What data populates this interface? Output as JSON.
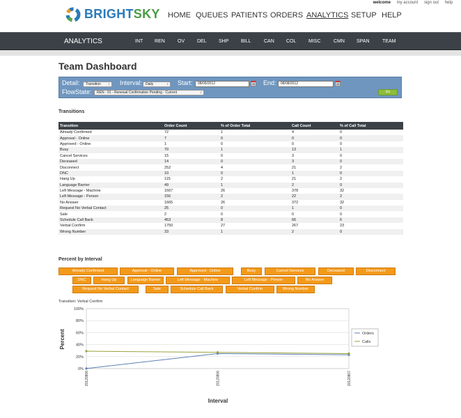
{
  "header": {
    "brand_a": "BRIGHT",
    "brand_b": "SKY",
    "util": {
      "welcome": "welcome",
      "account": "my account",
      "signout": "sign out",
      "help": "help"
    },
    "nav": [
      "HOME",
      "QUEUES",
      "PATIENTS",
      "ORDERS",
      "ANALYTICS",
      "SETUP",
      "HELP"
    ],
    "active_nav": "ANALYTICS"
  },
  "subnav": {
    "title": "ANALYTICS",
    "items": [
      "INT",
      "REN",
      "OV",
      "DEL",
      "SHP",
      "BILL",
      "CAN",
      "COL",
      "MISC",
      "CMN",
      "SPAN",
      "TEAM"
    ]
  },
  "page_title": "Team Dashboard",
  "filters": {
    "detail_label": "Detail:",
    "detail_value": "Transition",
    "interval_label": "Interval:",
    "interval_value": "Daily",
    "start_label": "Start:",
    "start_value": "08/05/2012",
    "end_label": "End:",
    "end_value": "08/08/2012",
    "flowstate_label": "FlowState:",
    "flowstate_value": "REN - 01 - Renewal Confirmation Pending - Current",
    "go_label": "Go",
    "cal_icon_text": "28"
  },
  "transitions": {
    "heading": "Transitions",
    "columns": [
      "Transition",
      "Order Count",
      "% of Order Total",
      "Call Count",
      "% of Call Total"
    ],
    "rows": [
      [
        "Already Confirmed",
        "72",
        "1",
        "4",
        "0"
      ],
      [
        "Approval - Online",
        "7",
        "0",
        "0",
        "0"
      ],
      [
        "Approved - Online",
        "1",
        "0",
        "0",
        "0"
      ],
      [
        "Busy",
        "70",
        "1",
        "13",
        "1"
      ],
      [
        "Cancel Services",
        "15",
        "0",
        "3",
        "0"
      ],
      [
        "Deceased",
        "14",
        "0",
        "3",
        "0"
      ],
      [
        "Disconnect",
        "252",
        "4",
        "21",
        "2"
      ],
      [
        "DNC",
        "10",
        "0",
        "1",
        "0"
      ],
      [
        "Hang Up",
        "115",
        "2",
        "21",
        "2"
      ],
      [
        "Language Barrier",
        "49",
        "1",
        "2",
        "0"
      ],
      [
        "Left Message - Machine",
        "1667",
        "26",
        "378",
        "32"
      ],
      [
        "Left Message - Person",
        "156",
        "2",
        "22",
        "2"
      ],
      [
        "No Answer",
        "1665",
        "26",
        "372",
        "32"
      ],
      [
        "Request No Verbal Contact",
        "25",
        "0",
        "1",
        "0"
      ],
      [
        "Sale",
        "2",
        "0",
        "0",
        "0"
      ],
      [
        "Schedule Call Back",
        "453",
        "8",
        "66",
        "6"
      ],
      [
        "Verbal Confirm",
        "1750",
        "27",
        "267",
        "23"
      ],
      [
        "Wrong Number",
        "33",
        "1",
        "2",
        "0"
      ]
    ]
  },
  "percent_heading": "Percent by Interval",
  "interval_buttons": [
    [
      "Already Confirmed",
      "Approval - Online",
      "Approved - Online",
      "Busy",
      "Cancel Services",
      "Deceased",
      "Disconnect"
    ],
    [
      "DNC",
      "Hang Up",
      "Language Barrier",
      "Left Message - Machine",
      "Left Message - Person",
      "No Answer"
    ],
    [
      "Request No Verbal Contact",
      "Sale",
      "Schedule Call Back",
      "Verbal Confirm",
      "Wrong Number"
    ]
  ],
  "chart_data": {
    "type": "line",
    "title": "Transition: Verbal Confirm",
    "xlabel": "Interval",
    "ylabel": "Percent",
    "x": [
      "20120806",
      "20120806",
      "20120807"
    ],
    "ylim": [
      0,
      100
    ],
    "yticks": [
      "0%",
      "20%",
      "40%",
      "60%",
      "80%",
      "100%"
    ],
    "grid": true,
    "legend_position": "right",
    "series": [
      {
        "name": "Orders",
        "values": [
          0,
          25,
          23
        ],
        "color": "#5b7fb5"
      },
      {
        "name": "Calls",
        "values": [
          29,
          27,
          25
        ],
        "color": "#9aa23a"
      }
    ]
  }
}
